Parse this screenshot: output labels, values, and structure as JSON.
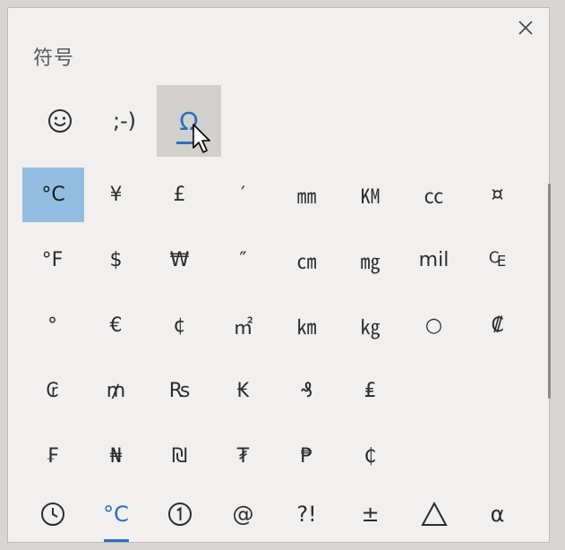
{
  "panel": {
    "title": "符号"
  },
  "category_tabs": [
    {
      "name": "emoji",
      "icon": "smiley-icon",
      "label": "",
      "active": false
    },
    {
      "name": "kaomoji",
      "icon": "kaomoji-icon",
      "label": ";-)",
      "active": false
    },
    {
      "name": "symbols",
      "icon": "omega-icon",
      "label": "Ω",
      "active": true
    }
  ],
  "symbols": [
    "°C",
    "¥",
    "£",
    "′",
    "㎜",
    "㏎",
    "㏄",
    "¤",
    "°F",
    "$",
    "₩",
    "″",
    "㎝",
    "㎎",
    "mil",
    "₠",
    "°",
    "€",
    "¢",
    "㎡",
    "㎞",
    "㎏",
    "○",
    "₡",
    "₢",
    "₥",
    "₨",
    "₭",
    "₰",
    "₤",
    "",
    "",
    "₣",
    "₦",
    "₪",
    "₮",
    "₱",
    "₵",
    "",
    ""
  ],
  "selected_index": 0,
  "bottom_tabs": [
    {
      "name": "recent",
      "icon": "clock-icon",
      "label": "",
      "active": false
    },
    {
      "name": "currency-units",
      "icon": "",
      "label": "°C",
      "active": true
    },
    {
      "name": "enclosed",
      "icon": "circled-one-icon",
      "label": "",
      "active": false
    },
    {
      "name": "punctuation",
      "icon": "",
      "label": "@",
      "active": false
    },
    {
      "name": "marks",
      "icon": "",
      "label": "?!",
      "active": false
    },
    {
      "name": "math",
      "icon": "",
      "label": "±",
      "active": false
    },
    {
      "name": "geometric",
      "icon": "triangle-icon",
      "label": "",
      "active": false
    },
    {
      "name": "greek",
      "icon": "",
      "label": "α",
      "active": false
    }
  ],
  "colors": {
    "accent": "#2a6ebd",
    "selected_bg": "#93bde0",
    "tab_active_bg": "#d2d0cc"
  }
}
